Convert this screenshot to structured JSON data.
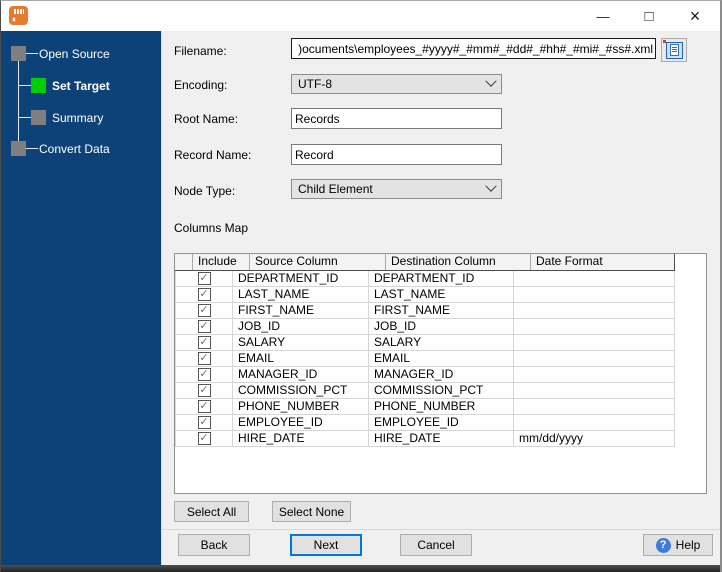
{
  "window": {
    "title": "",
    "controls": {
      "minimize": "—",
      "maximize": "□",
      "close": "×"
    }
  },
  "sidebar": {
    "steps": [
      {
        "label": "Open Source",
        "state": "completed"
      },
      {
        "label": "Set Target",
        "state": "active"
      },
      {
        "label": "Summary",
        "state": "pending"
      },
      {
        "label": "Convert Data",
        "state": "pending"
      }
    ]
  },
  "form": {
    "filename": {
      "label": "Filename:",
      "value": ")ocuments\\employees_#yyyy#_#mm#_#dd#_#hh#_#mi#_#ss#.xml"
    },
    "encoding": {
      "label": "Encoding:",
      "value": "UTF-8"
    },
    "root_name": {
      "label": "Root Name:",
      "value": "Records"
    },
    "record_name": {
      "label": "Record Name:",
      "value": "Record"
    },
    "node_type": {
      "label": "Node Type:",
      "value": "Child Element"
    }
  },
  "columns_map": {
    "section_label": "Columns Map",
    "headers": {
      "include": "Include",
      "source": "Source Column",
      "destination": "Destination Column",
      "date_format": "Date Format"
    },
    "rows": [
      {
        "include": true,
        "source": "DEPARTMENT_ID",
        "destination": "DEPARTMENT_ID",
        "date_format": ""
      },
      {
        "include": true,
        "source": "LAST_NAME",
        "destination": "LAST_NAME",
        "date_format": ""
      },
      {
        "include": true,
        "source": "FIRST_NAME",
        "destination": "FIRST_NAME",
        "date_format": ""
      },
      {
        "include": true,
        "source": "JOB_ID",
        "destination": "JOB_ID",
        "date_format": ""
      },
      {
        "include": true,
        "source": "SALARY",
        "destination": "SALARY",
        "date_format": ""
      },
      {
        "include": true,
        "source": "EMAIL",
        "destination": "EMAIL",
        "date_format": ""
      },
      {
        "include": true,
        "source": "MANAGER_ID",
        "destination": "MANAGER_ID",
        "date_format": ""
      },
      {
        "include": true,
        "source": "COMMISSION_PCT",
        "destination": "COMMISSION_PCT",
        "date_format": ""
      },
      {
        "include": true,
        "source": "PHONE_NUMBER",
        "destination": "PHONE_NUMBER",
        "date_format": ""
      },
      {
        "include": true,
        "source": "EMPLOYEE_ID",
        "destination": "EMPLOYEE_ID",
        "date_format": ""
      },
      {
        "include": true,
        "source": "HIRE_DATE",
        "destination": "HIRE_DATE",
        "date_format": "mm/dd/yyyy"
      }
    ]
  },
  "buttons": {
    "select_all": "Select All",
    "select_none": "Select None",
    "back": "Back",
    "next": "Next",
    "cancel": "Cancel",
    "help": "Help"
  },
  "icons": {
    "browse": "document-icon",
    "help": "?",
    "checkbox_check": "✓"
  },
  "colors": {
    "sidebar_bg": "#0C4278",
    "step_active": "#00CE00",
    "step_inactive": "#7F7F7F",
    "accent_blue": "#0078D7",
    "app_icon_orange": "#E87A2E",
    "help_icon_blue": "#3E7BDB"
  }
}
